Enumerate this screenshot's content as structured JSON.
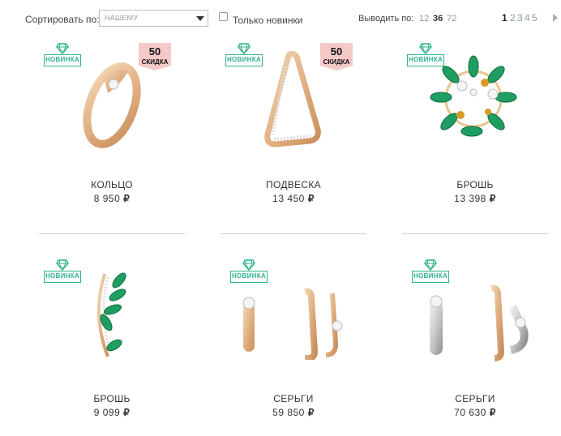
{
  "toolbar": {
    "sort_label": "Сортировать по:",
    "sort_value": "НАШЕМУ",
    "new_only_label": "Только новинки",
    "new_only_checked": false,
    "show_label": "Выводить по:",
    "show_options": [
      "12",
      "36",
      "72"
    ],
    "show_active": "36",
    "pages": [
      "1",
      "2",
      "3",
      "4",
      "5"
    ],
    "page_active": "1",
    "next_icon": "arrow-right-icon"
  },
  "badges": {
    "new_text": "НОВИНКА",
    "sale_text": "СКИДКА",
    "new_color": "#2fb38c",
    "sale_color": "#f6c9c9"
  },
  "currency": "₽",
  "products": [
    {
      "name": "КОЛЬЦО",
      "price": "8 950",
      "is_new": true,
      "sale": "50",
      "image": "ring"
    },
    {
      "name": "ПОДВЕСКА",
      "price": "13 450",
      "is_new": true,
      "sale": "50",
      "image": "pendant"
    },
    {
      "name": "БРОШЬ",
      "price": "13 398",
      "is_new": true,
      "sale": null,
      "image": "wreath-brooch"
    },
    {
      "name": "БРОШЬ",
      "price": "9 099",
      "is_new": true,
      "sale": null,
      "image": "leaf-brooch"
    },
    {
      "name": "СЕРЬГИ",
      "price": "59 850",
      "is_new": true,
      "sale": null,
      "image": "earrings-gold"
    },
    {
      "name": "СЕРЬГИ",
      "price": "70 630",
      "is_new": true,
      "sale": null,
      "image": "earrings-twotone"
    }
  ]
}
